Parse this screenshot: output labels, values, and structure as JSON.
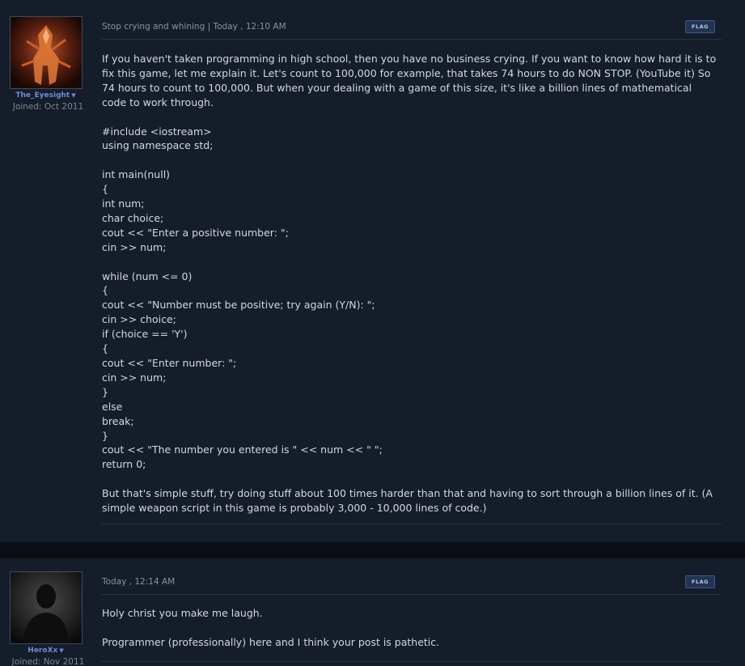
{
  "posts": [
    {
      "username": "The_Eyesight",
      "joined": "Joined: Oct 2011",
      "meta": "Stop crying and whining | Today , 12:10 AM",
      "flag_label": "FLAG",
      "intro": "If you haven't taken programming in high school, then you have no business crying. If you want to know how hard it is to fix this game, let me explain it. Let's count to 100,000 for example, that takes 74 hours to do NON STOP. (YouTube it) So 74 hours to count to 100,000. But when your dealing with a game of this size, it's like a billion lines of mathematical code to work through.",
      "code": [
        "#include <iostream>",
        "using namespace std;",
        "",
        "int main(null)",
        "{",
        "int num;",
        "char choice;",
        "cout << \"Enter a positive number: \";",
        "cin >> num;",
        "",
        "while (num <= 0)",
        "{",
        "cout << \"Number must be positive; try again (Y/N): \";",
        "cin >> choice;",
        "if (choice == 'Y')",
        "{",
        "cout << \"Enter number: \";",
        "cin >> num;",
        "}",
        "else",
        "break;",
        "}",
        "cout << \"The number you entered is \" << num << \" \";",
        "return 0;"
      ],
      "outro": "But that's simple stuff, try doing stuff about 100 times harder than that and having to sort through a billion lines of it. (A simple weapon script in this game is probably 3,000 - 10,000 lines of code.)"
    },
    {
      "username": "HeroXx",
      "joined": "Joined: Nov 2011",
      "meta": "Today , 12:14 AM",
      "flag_label": "FLAG",
      "para1": "Holy christ you make me laugh.",
      "para2": "Programmer (professionally) here and I think your post is pathetic."
    }
  ],
  "icons": {
    "user_menu_caret": "caret-down-icon"
  },
  "colors": {
    "username": "#6d8ed2",
    "flag_bg": "#233352",
    "post_bg": "#151c2a"
  }
}
